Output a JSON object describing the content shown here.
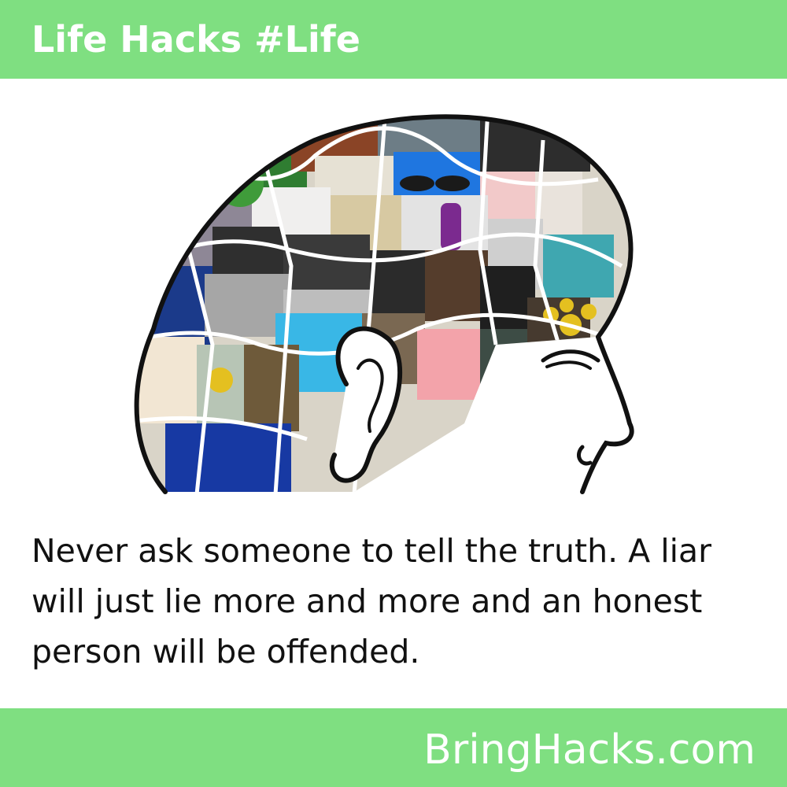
{
  "header": {
    "title": "Life Hacks #Life",
    "background_color": "#7fdf81"
  },
  "illustration": {
    "subject": "head-profile-collage-icon"
  },
  "hack": {
    "text": "Never ask someone to tell the truth. A liar will just lie more and more and an honest person will be offended."
  },
  "footer": {
    "site": "BringHacks.com",
    "background_color": "#7fdf81"
  }
}
